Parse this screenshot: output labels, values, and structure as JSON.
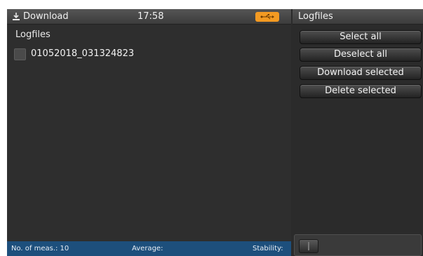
{
  "header": {
    "title": "Download",
    "time": "17:58",
    "download_icon": "download-icon",
    "usb_icon": "usb-icon",
    "usb_badge_color": "#f39a22"
  },
  "main": {
    "section_title": "Logfiles",
    "files": [
      {
        "name": "01052018_031324823",
        "checked": false
      }
    ]
  },
  "status_bar": {
    "meas_label": "No. of meas.: 10",
    "average_label": "Average:",
    "stability_label": "Stability:",
    "color": "#1d4f7c"
  },
  "right_panel": {
    "title": "Logfiles",
    "buttons": [
      "Select all",
      "Deselect all",
      "Download selected",
      "Delete selected"
    ]
  }
}
